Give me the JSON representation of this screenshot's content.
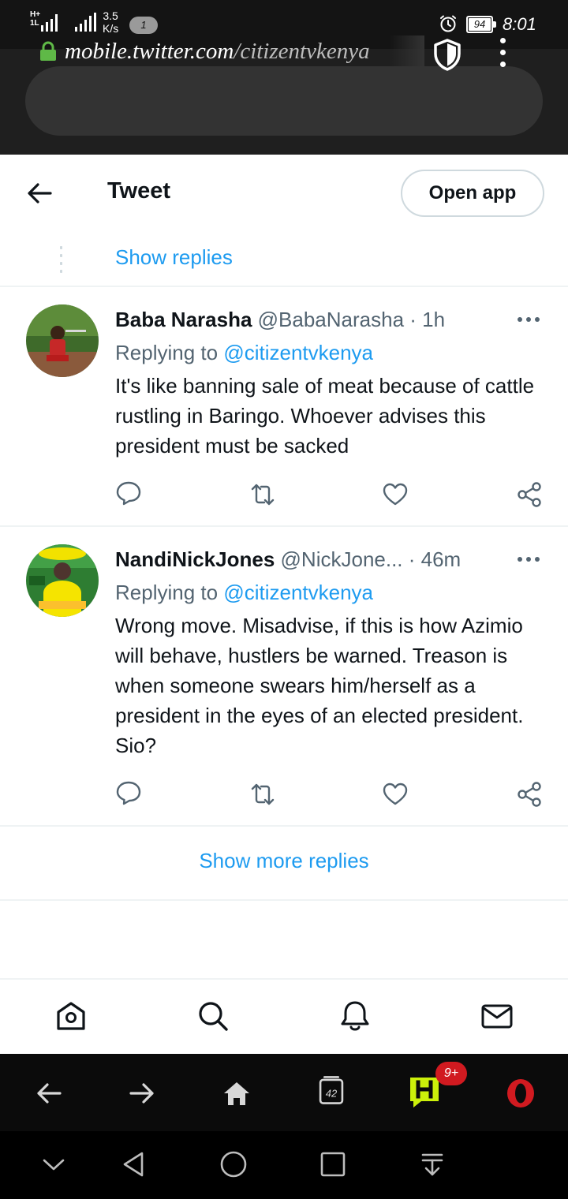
{
  "status_bar": {
    "network_label_1": "H+",
    "network_label_2": "1L",
    "speed_value": "3.5",
    "speed_unit": "K/s",
    "notification_count": "1",
    "battery_level": "94",
    "time": "8:01"
  },
  "browser": {
    "url_domain": "mobile.twitter.com",
    "url_path": "/citizentvkenya"
  },
  "header": {
    "title": "Tweet",
    "open_app_label": "Open app"
  },
  "thread": {
    "show_replies_label": "Show replies"
  },
  "tweets": [
    {
      "display_name": "Baba Narasha",
      "handle": "@BabaNarasha",
      "separator": " · ",
      "time": "1h",
      "replying_prefix": "Replying to ",
      "replying_to": "@citizentvkenya",
      "text": "It's like banning sale of meat because of cattle rustling in Baringo. Whoever advises this president must be sacked"
    },
    {
      "display_name": "NandiNickJones",
      "handle": "@NickJone...",
      "separator": " · ",
      "time": "46m",
      "replying_prefix": "Replying to ",
      "replying_to": "@citizentvkenya",
      "text": "Wrong move. Misadvise, if this is how Azimio will behave, hustlers be warned. Treason is when someone swears him/herself as a president in the eyes of an elected president. Sio?"
    }
  ],
  "show_more_replies_label": "Show more replies",
  "browser_toolbar": {
    "tabs_count": "42",
    "notifications_badge": "9+"
  },
  "colors": {
    "twitter_blue": "#1d9bf0",
    "text_primary": "#0f1419",
    "text_secondary": "#536471",
    "opera_red": "#d11a20",
    "hype_green": "#ccf00a"
  }
}
